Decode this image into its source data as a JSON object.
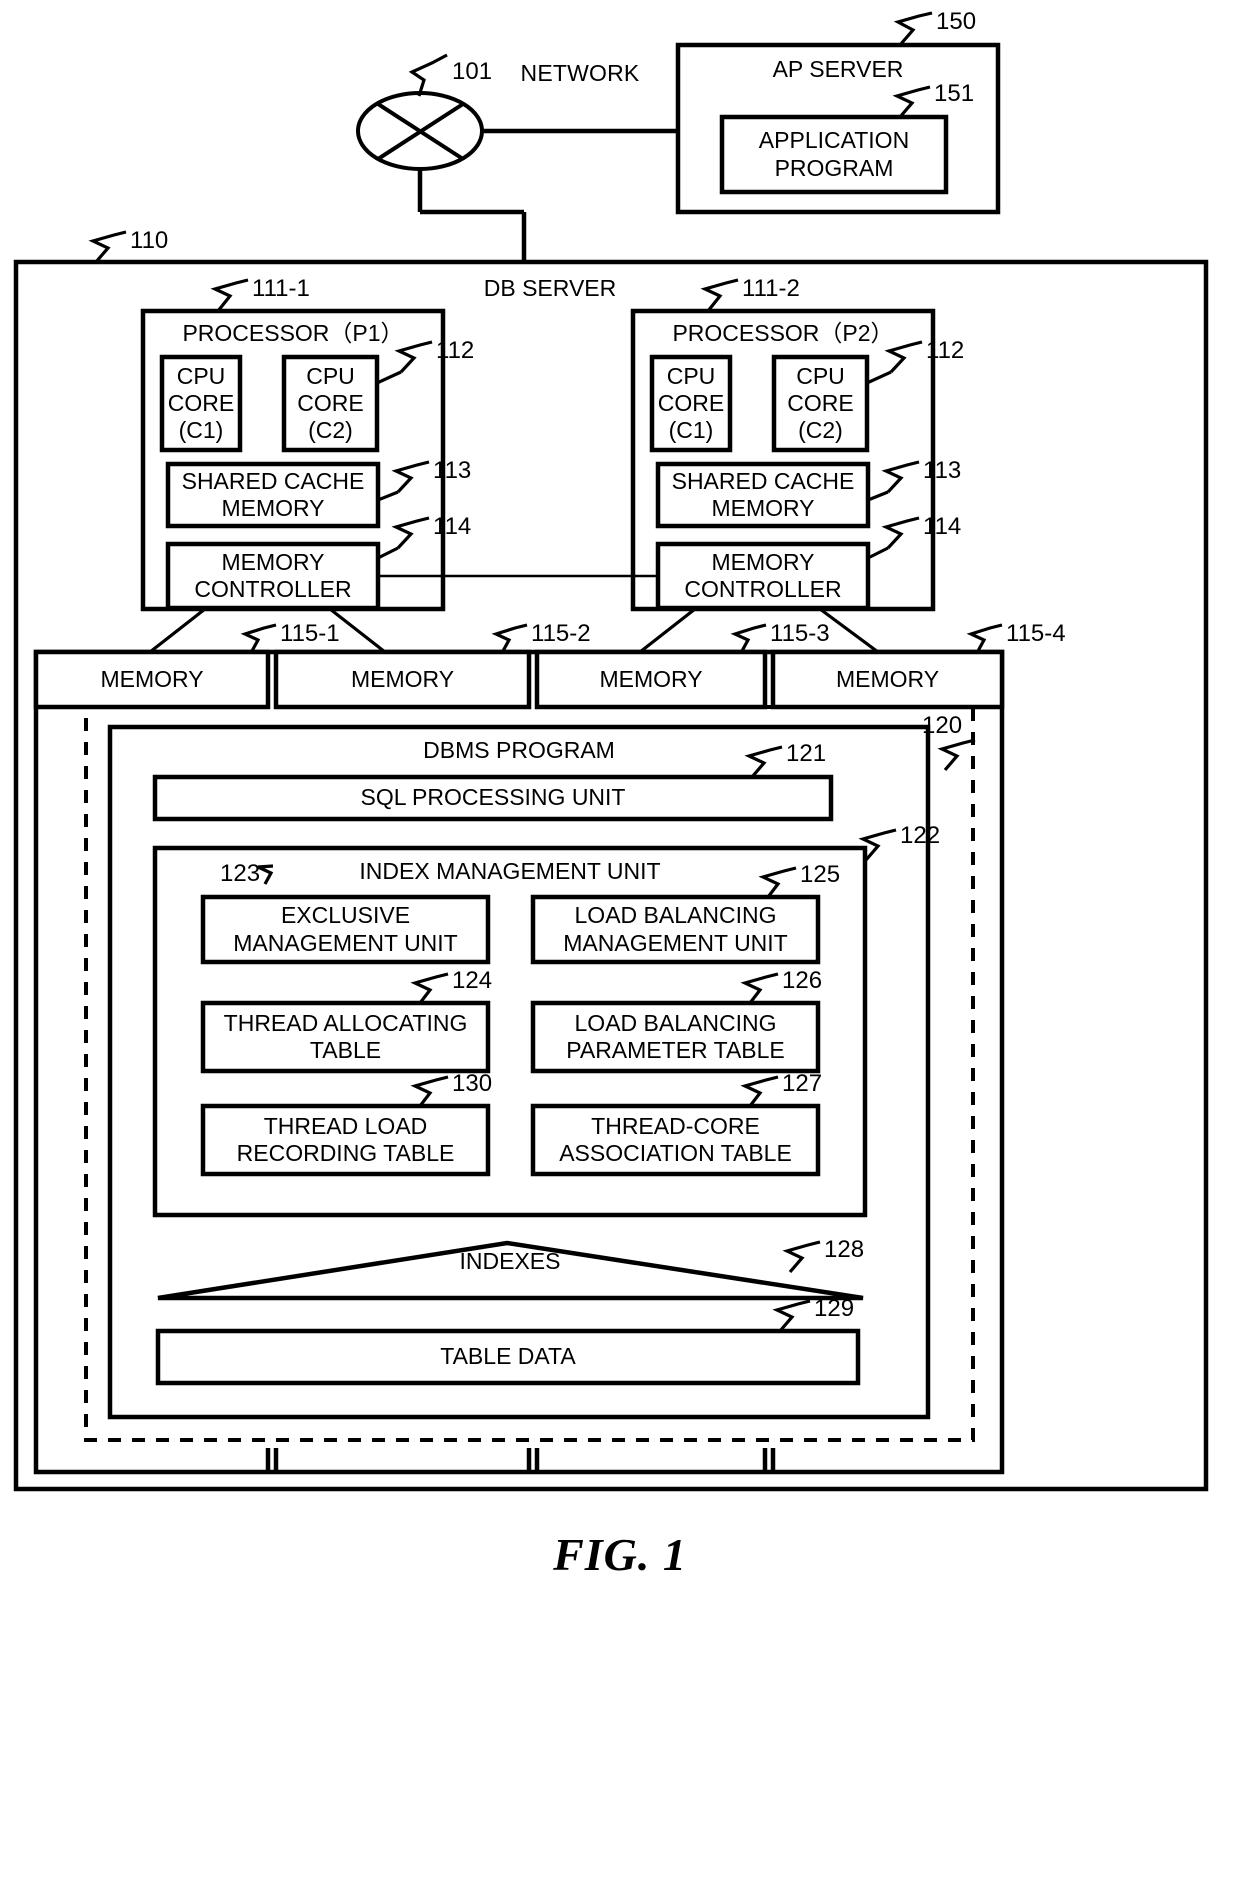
{
  "figure": {
    "caption": "FIG. 1"
  },
  "network": {
    "ref": "101",
    "label": "NETWORK",
    "icon": "network-cloud-x-icon"
  },
  "ap_server": {
    "ref": "150",
    "title": "AP SERVER",
    "application_program": {
      "ref": "151",
      "label": "APPLICATION\nPROGRAM"
    }
  },
  "db_server": {
    "ref": "110",
    "title": "DB SERVER",
    "processors": [
      {
        "ref": "111-1",
        "title": "PROCESSOR（P1）",
        "cores": [
          {
            "ref": "112",
            "label": "CPU\nCORE\n(C1)"
          },
          {
            "ref": "112",
            "label": "CPU\nCORE\n(C2)"
          }
        ],
        "shared_cache": {
          "ref": "113",
          "label": "SHARED CACHE\nMEMORY"
        },
        "memory_controller": {
          "ref": "114",
          "label": "MEMORY\nCONTROLLER"
        }
      },
      {
        "ref": "111-2",
        "title": "PROCESSOR（P2）",
        "cores": [
          {
            "ref": "112",
            "label": "CPU\nCORE\n(C1)"
          },
          {
            "ref": "112",
            "label": "CPU\nCORE\n(C2)"
          }
        ],
        "shared_cache": {
          "ref": "113",
          "label": "SHARED CACHE\nMEMORY"
        },
        "memory_controller": {
          "ref": "114",
          "label": "MEMORY\nCONTROLLER"
        }
      }
    ],
    "memories": [
      {
        "ref": "115-1",
        "label": "MEMORY"
      },
      {
        "ref": "115-2",
        "label": "MEMORY"
      },
      {
        "ref": "115-3",
        "label": "MEMORY"
      },
      {
        "ref": "115-4",
        "label": "MEMORY"
      }
    ],
    "dbms": {
      "ref": "120",
      "title": "DBMS PROGRAM",
      "sql_processing_unit": {
        "ref": "121",
        "label": "SQL PROCESSING UNIT"
      },
      "index_management_unit": {
        "ref": "122",
        "title": "INDEX MANAGEMENT UNIT",
        "units": [
          {
            "ref": "123",
            "label": "EXCLUSIVE\nMANAGEMENT UNIT"
          },
          {
            "ref": "125",
            "label": "LOAD BALANCING\nMANAGEMENT UNIT"
          },
          {
            "ref": "124",
            "label": "THREAD ALLOCATING\nTABLE"
          },
          {
            "ref": "126",
            "label": "LOAD BALANCING\nPARAMETER TABLE"
          },
          {
            "ref": "130",
            "label": "THREAD LOAD\nRECORDING TABLE"
          },
          {
            "ref": "127",
            "label": "THREAD-CORE\nASSOCIATION TABLE"
          }
        ]
      },
      "indexes": {
        "ref": "128",
        "label": "INDEXES"
      },
      "table_data": {
        "ref": "129",
        "label": "TABLE DATA"
      }
    }
  },
  "colors": {
    "line": "#000000",
    "background": "#ffffff"
  }
}
